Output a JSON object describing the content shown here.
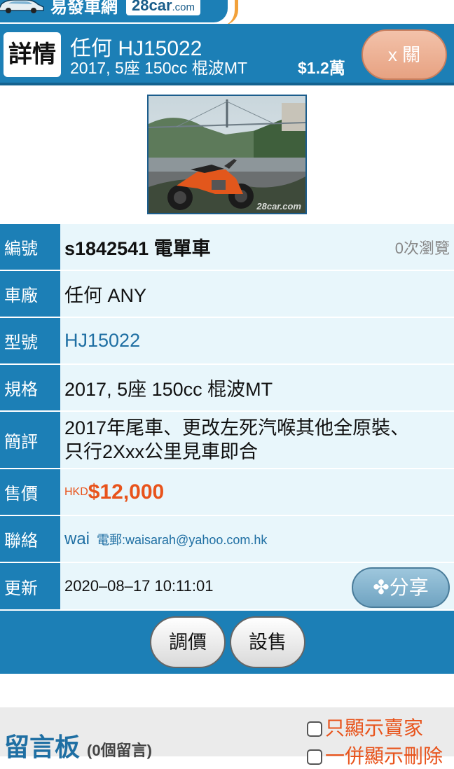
{
  "brand": {
    "name_zh": "易發車網",
    "name_en": "28car",
    "domain": ".com"
  },
  "header": {
    "tag": "詳情",
    "title": "任何 HJ15022",
    "spec": "2017, 5座 150cc 棍波MT",
    "price": "$1.2萬",
    "close_label": "x 關"
  },
  "photo": {
    "watermark": "28car.com"
  },
  "details": {
    "id": {
      "label": "編號",
      "value": "s1842541 電單車",
      "views": "0次瀏覽"
    },
    "make": {
      "label": "車廠",
      "value": "任何 ANY"
    },
    "model": {
      "label": "型號",
      "value": "HJ15022"
    },
    "spec": {
      "label": "規格",
      "value": "2017, 5座 150cc 棍波MT"
    },
    "remarks": {
      "label": "簡評",
      "line1": "2017年尾車、更改左死汽喉其他全原裝、",
      "line2": "只行2Xxx公里見車即合"
    },
    "price": {
      "label": "售價",
      "currency": "HKD",
      "amount": "$12,000"
    },
    "contact": {
      "label": "聯絡",
      "name": "wai",
      "email": "電郵:waisarah@yahoo.com.hk"
    },
    "updated": {
      "label": "更新",
      "value": "2020–08–17 10:11:01",
      "share_label": "✤分享"
    }
  },
  "actions": {
    "adjust_price": "調價",
    "mark_sold": "設售"
  },
  "message_board": {
    "title": "留言板",
    "count": "(0個留言)",
    "filter_seller": "只顯示賣家",
    "filter_deleted": "一併顯示刪除"
  },
  "colors": {
    "primary": "#1c7fb6",
    "accent": "#e8531b",
    "row_bg": "#e8f6fb"
  }
}
